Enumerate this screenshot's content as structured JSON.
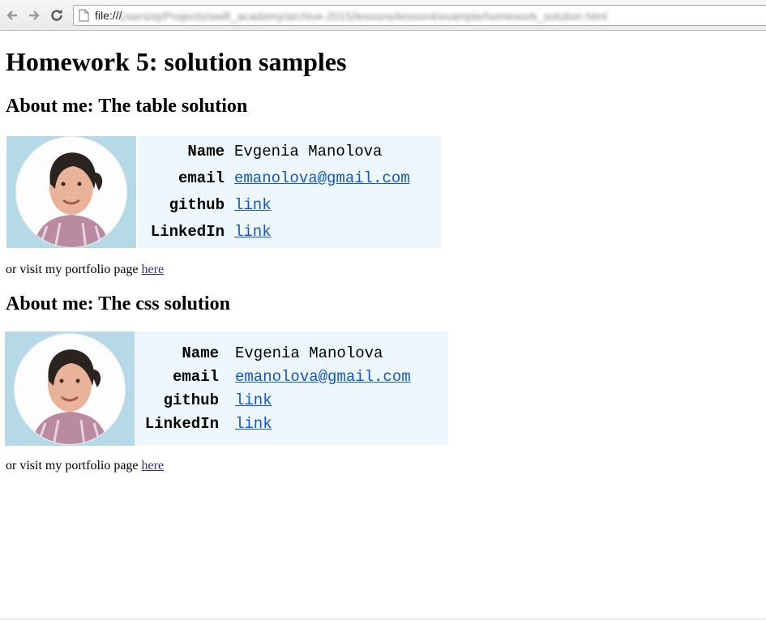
{
  "browser": {
    "url_scheme": "file:///",
    "url_path": "Users/ej/Projects/swift_academy/archive-2015/lessons/lesson4/example/homework_solution.html",
    "icons": [
      "back-arrow-icon",
      "forward-arrow-icon",
      "reload-icon",
      "page-icon"
    ]
  },
  "page": {
    "title": "Homework 5: solution samples",
    "section_table": {
      "heading": "About me: The table solution",
      "rows": [
        {
          "key": "Name",
          "value": "Evgenia Manolova"
        },
        {
          "key": "email",
          "value": "emanolova@gmail.com"
        },
        {
          "key": "github",
          "value": "link"
        },
        {
          "key": "LinkedIn",
          "value": "link"
        }
      ],
      "portfolio_text": "or visit my portfolio page ",
      "portfolio_link": "here"
    },
    "section_css": {
      "heading": "About me: The css solution",
      "rows": [
        {
          "key": "Name",
          "value": "Evgenia Manolova"
        },
        {
          "key": "email",
          "value": "emanolova@gmail.com"
        },
        {
          "key": "github",
          "value": "link"
        },
        {
          "key": "LinkedIn",
          "value": "link"
        }
      ],
      "portfolio_text": "or visit my portfolio page ",
      "portfolio_link": "here"
    }
  },
  "colors": {
    "photo_bg": "#b5d9e6",
    "info_bg": "#eff7fe",
    "link": "#1155cc"
  }
}
